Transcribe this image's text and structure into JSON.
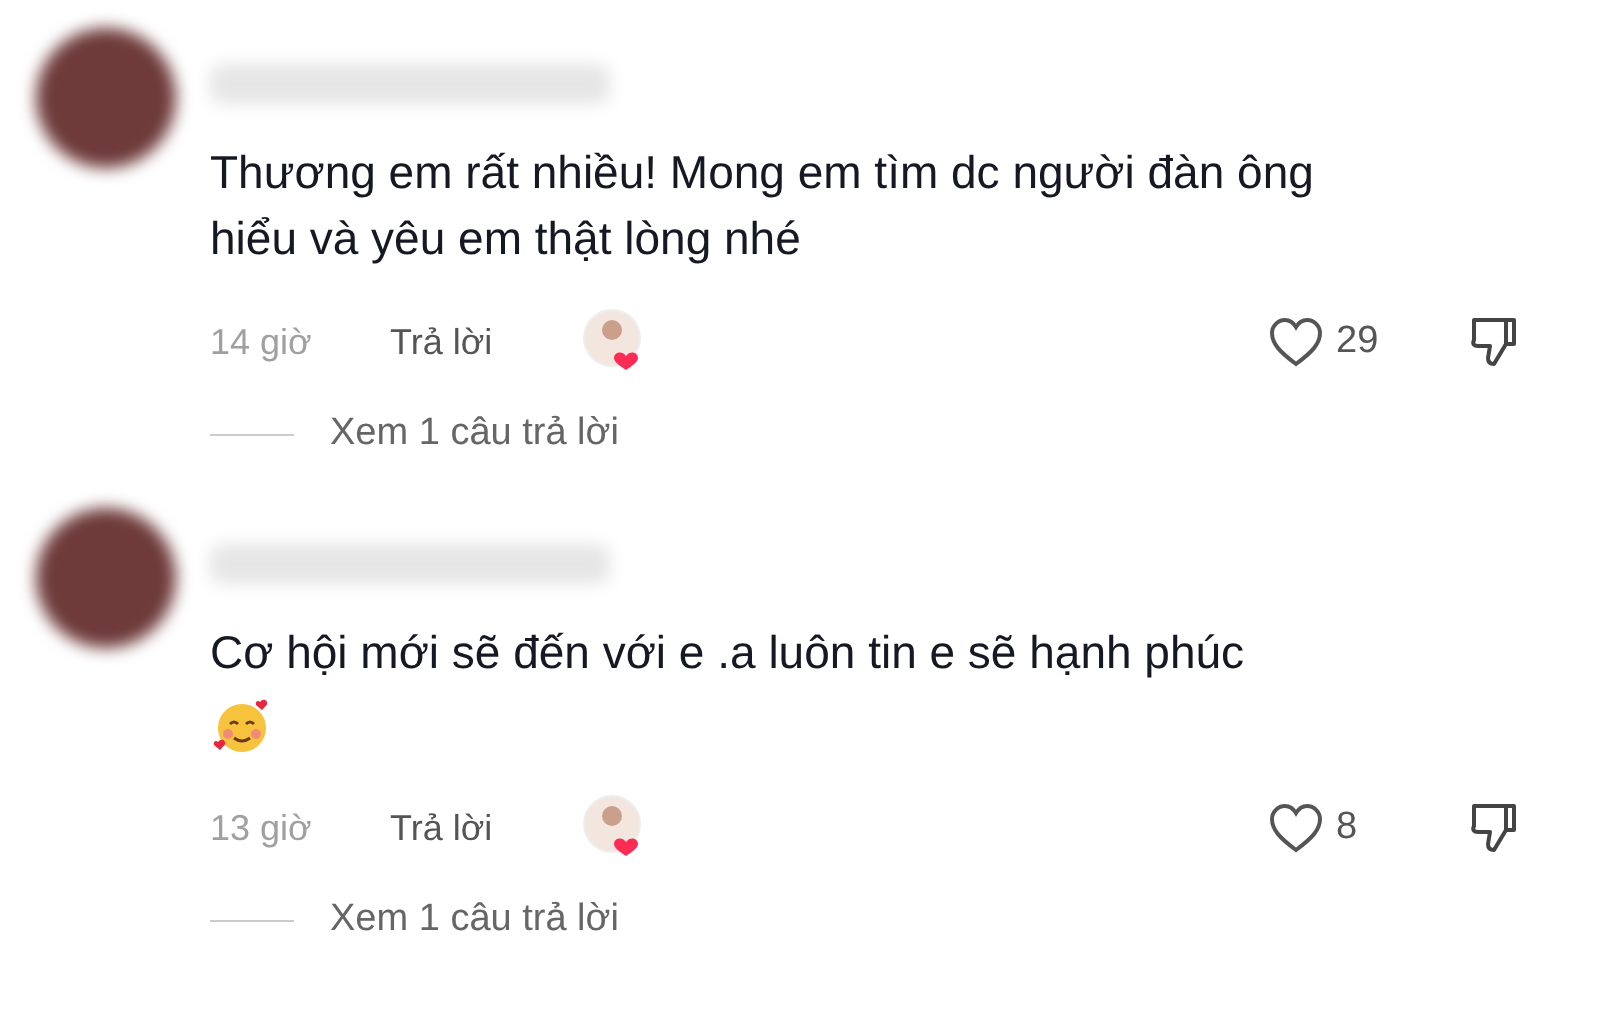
{
  "comments": [
    {
      "text": "Thương em rất nhiều! Mong em tìm dc người đàn ông hiểu và yêu em thật lòng nhé",
      "emoji_line": false,
      "time": "14 giờ",
      "reply_label": "Trả lời",
      "liked_by_creator": true,
      "likes": "29",
      "view_replies": "Xem 1 câu trả lời"
    },
    {
      "text": "Cơ hội mới sẽ đến với e .a luôn tin e sẽ hạnh phúc",
      "emoji_line": true,
      "time": "13 giờ",
      "reply_label": "Trả lời",
      "liked_by_creator": true,
      "likes": "8",
      "view_replies": "Xem 1 câu trả lời"
    }
  ]
}
